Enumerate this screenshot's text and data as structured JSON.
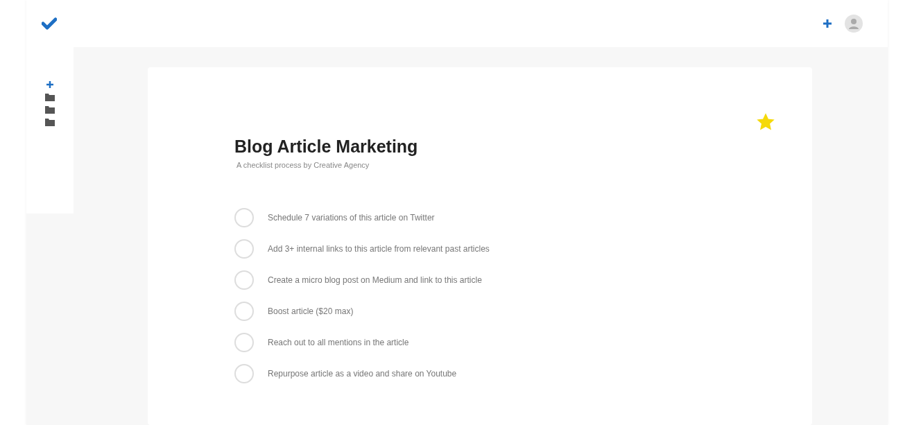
{
  "checklist": {
    "title": "Blog Article Marketing",
    "subtitle": "A checklist process by Creative Agency",
    "starred": true,
    "tasks": [
      {
        "label": "Schedule 7 variations of this article on Twitter",
        "checked": false
      },
      {
        "label": "Add 3+ internal links to this article from relevant past articles",
        "checked": false
      },
      {
        "label": "Create a micro blog post on Medium and link to this article",
        "checked": false
      },
      {
        "label": "Boost article ($20 max)",
        "checked": false
      },
      {
        "label": "Reach out to all mentions in the article",
        "checked": false
      },
      {
        "label": "Repurpose article as a video and share on Youtube",
        "checked": false
      }
    ]
  }
}
